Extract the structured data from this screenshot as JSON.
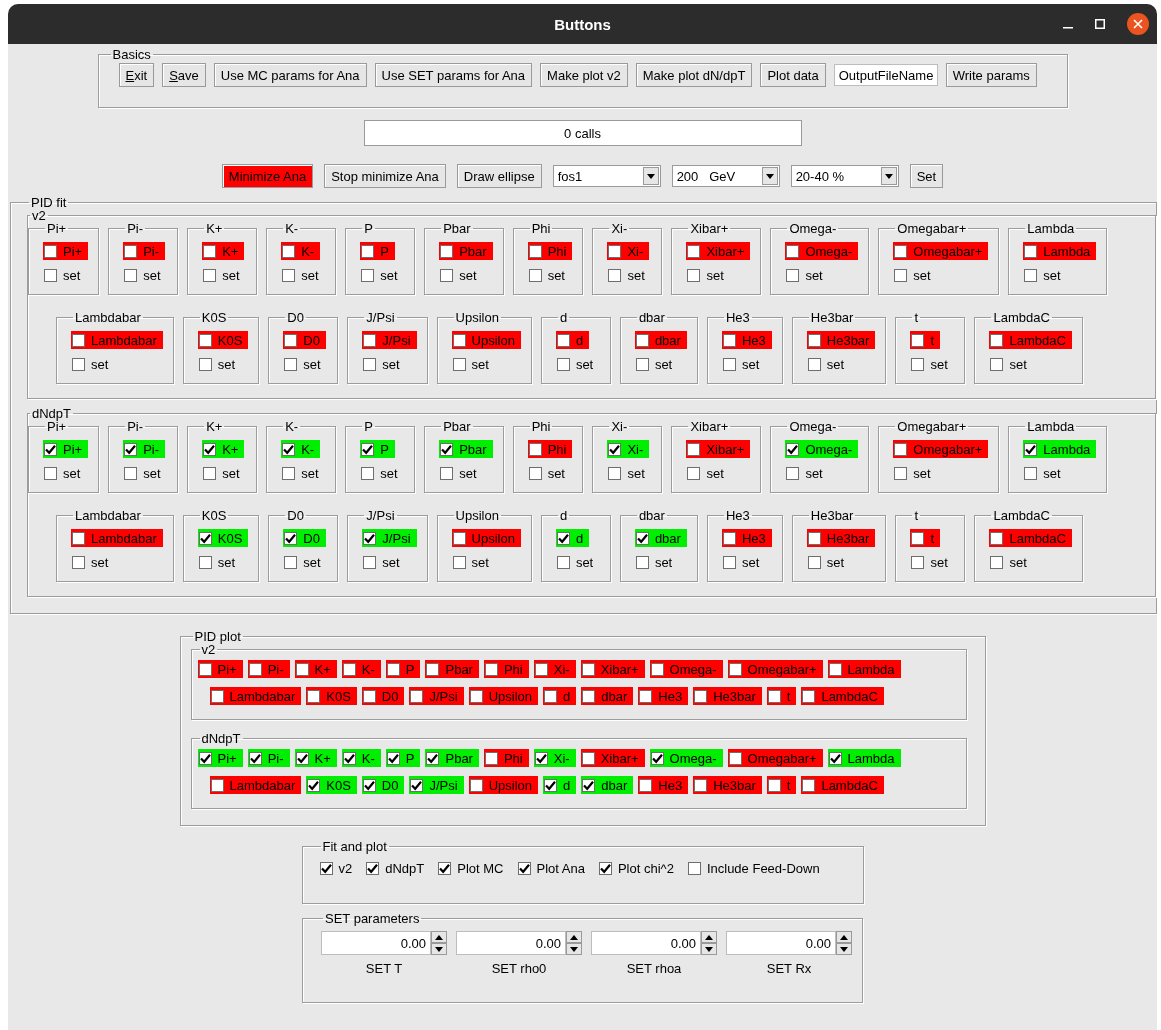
{
  "window": {
    "title": "Buttons"
  },
  "basics": {
    "title": "Basics",
    "items": [
      {
        "kind": "button",
        "label": "Exit",
        "mnemonic": true
      },
      {
        "kind": "button",
        "label": "Save",
        "mnemonic": true
      },
      {
        "kind": "button",
        "label": "Use MC params for Ana",
        "mnemonic": false
      },
      {
        "kind": "button",
        "label": "Use SET params for Ana",
        "mnemonic": false
      },
      {
        "kind": "button",
        "label": "Make plot v2",
        "mnemonic": false
      },
      {
        "kind": "button",
        "label": "Make plot dN/dpT",
        "mnemonic": false
      },
      {
        "kind": "button",
        "label": "Plot data",
        "mnemonic": false
      },
      {
        "kind": "field",
        "value": "OutputFileName"
      },
      {
        "kind": "button",
        "label": "Write params",
        "mnemonic": false
      }
    ]
  },
  "status": {
    "value": "0 calls"
  },
  "controls": [
    {
      "kind": "button",
      "label": "Minimize Ana",
      "active": true
    },
    {
      "kind": "button",
      "label": "Stop minimize Ana",
      "active": false
    },
    {
      "kind": "button",
      "label": "Draw ellipse",
      "active": false
    },
    {
      "kind": "dropdown",
      "value": "fos1"
    },
    {
      "kind": "dropdown",
      "value": "200   GeV"
    },
    {
      "kind": "dropdown",
      "value": "20-40 %"
    },
    {
      "kind": "button",
      "label": "Set",
      "active": false
    }
  ],
  "pid_fit": {
    "title": "PID fit",
    "sections": [
      {
        "title": "v2",
        "row_1": [
          {
            "group": "Pi+",
            "label": "Pi+",
            "checked": false,
            "set": {
              "label": "set",
              "checked": false
            }
          },
          {
            "group": "Pi-",
            "label": "Pi-",
            "checked": false,
            "set": {
              "label": "set",
              "checked": false
            }
          },
          {
            "group": "K+",
            "label": "K+",
            "checked": false,
            "set": {
              "label": "set",
              "checked": false
            }
          },
          {
            "group": "K-",
            "label": "K-",
            "checked": false,
            "set": {
              "label": "set",
              "checked": false
            }
          },
          {
            "group": "P",
            "label": "P",
            "checked": false,
            "set": {
              "label": "set",
              "checked": false
            }
          },
          {
            "group": "Pbar",
            "label": "Pbar",
            "checked": false,
            "set": {
              "label": "set",
              "checked": false
            }
          },
          {
            "group": "Phi",
            "label": "Phi",
            "checked": false,
            "set": {
              "label": "set",
              "checked": false
            }
          },
          {
            "group": "Xi-",
            "label": "Xi-",
            "checked": false,
            "set": {
              "label": "set",
              "checked": false
            }
          },
          {
            "group": "Xibar+",
            "label": "Xibar+",
            "checked": false,
            "set": {
              "label": "set",
              "checked": false
            }
          },
          {
            "group": "Omega-",
            "label": "Omega-",
            "checked": false,
            "set": {
              "label": "set",
              "checked": false
            }
          },
          {
            "group": "Omegabar+",
            "label": "Omegabar+",
            "checked": false,
            "set": {
              "label": "set",
              "checked": false
            }
          },
          {
            "group": "Lambda",
            "label": "Lambda",
            "checked": false,
            "set": {
              "label": "set",
              "checked": false
            }
          }
        ],
        "row_2": [
          {
            "group": "Lambdabar",
            "label": "Lambdabar",
            "checked": false,
            "set": {
              "label": "set",
              "checked": false
            }
          },
          {
            "group": "K0S",
            "label": "K0S",
            "checked": false,
            "set": {
              "label": "set",
              "checked": false
            }
          },
          {
            "group": "D0",
            "label": "D0",
            "checked": false,
            "set": {
              "label": "set",
              "checked": false
            }
          },
          {
            "group": "J/Psi",
            "label": "J/Psi",
            "checked": false,
            "set": {
              "label": "set",
              "checked": false
            }
          },
          {
            "group": "Upsilon",
            "label": "Upsilon",
            "checked": false,
            "set": {
              "label": "set",
              "checked": false
            }
          },
          {
            "group": "d",
            "label": "d",
            "checked": false,
            "set": {
              "label": "set",
              "checked": false
            }
          },
          {
            "group": "dbar",
            "label": "dbar",
            "checked": false,
            "set": {
              "label": "set",
              "checked": false
            }
          },
          {
            "group": "He3",
            "label": "He3",
            "checked": false,
            "set": {
              "label": "set",
              "checked": false
            }
          },
          {
            "group": "He3bar",
            "label": "He3bar",
            "checked": false,
            "set": {
              "label": "set",
              "checked": false
            }
          },
          {
            "group": "t",
            "label": "t",
            "checked": false,
            "set": {
              "label": "set",
              "checked": false
            }
          },
          {
            "group": "LambdaC",
            "label": "LambdaC",
            "checked": false,
            "set": {
              "label": "set",
              "checked": false
            }
          }
        ]
      },
      {
        "title": "dNdpT",
        "row_1": [
          {
            "group": "Pi+",
            "label": "Pi+",
            "checked": true,
            "set": {
              "label": "set",
              "checked": false
            }
          },
          {
            "group": "Pi-",
            "label": "Pi-",
            "checked": true,
            "set": {
              "label": "set",
              "checked": false
            }
          },
          {
            "group": "K+",
            "label": "K+",
            "checked": true,
            "set": {
              "label": "set",
              "checked": false
            }
          },
          {
            "group": "K-",
            "label": "K-",
            "checked": true,
            "set": {
              "label": "set",
              "checked": false
            }
          },
          {
            "group": "P",
            "label": "P",
            "checked": true,
            "set": {
              "label": "set",
              "checked": false
            }
          },
          {
            "group": "Pbar",
            "label": "Pbar",
            "checked": true,
            "set": {
              "label": "set",
              "checked": false
            }
          },
          {
            "group": "Phi",
            "label": "Phi",
            "checked": false,
            "set": {
              "label": "set",
              "checked": false
            }
          },
          {
            "group": "Xi-",
            "label": "Xi-",
            "checked": true,
            "set": {
              "label": "set",
              "checked": false
            }
          },
          {
            "group": "Xibar+",
            "label": "Xibar+",
            "checked": false,
            "set": {
              "label": "set",
              "checked": false
            }
          },
          {
            "group": "Omega-",
            "label": "Omega-",
            "checked": true,
            "set": {
              "label": "set",
              "checked": false
            }
          },
          {
            "group": "Omegabar+",
            "label": "Omegabar+",
            "checked": false,
            "set": {
              "label": "set",
              "checked": false
            }
          },
          {
            "group": "Lambda",
            "label": "Lambda",
            "checked": true,
            "set": {
              "label": "set",
              "checked": false
            }
          }
        ],
        "row_2": [
          {
            "group": "Lambdabar",
            "label": "Lambdabar",
            "checked": false,
            "set": {
              "label": "set",
              "checked": false
            }
          },
          {
            "group": "K0S",
            "label": "K0S",
            "checked": true,
            "set": {
              "label": "set",
              "checked": false
            }
          },
          {
            "group": "D0",
            "label": "D0",
            "checked": true,
            "set": {
              "label": "set",
              "checked": false
            }
          },
          {
            "group": "J/Psi",
            "label": "J/Psi",
            "checked": true,
            "set": {
              "label": "set",
              "checked": false
            }
          },
          {
            "group": "Upsilon",
            "label": "Upsilon",
            "checked": false,
            "set": {
              "label": "set",
              "checked": false
            }
          },
          {
            "group": "d",
            "label": "d",
            "checked": true,
            "set": {
              "label": "set",
              "checked": false
            }
          },
          {
            "group": "dbar",
            "label": "dbar",
            "checked": true,
            "set": {
              "label": "set",
              "checked": false
            }
          },
          {
            "group": "He3",
            "label": "He3",
            "checked": false,
            "set": {
              "label": "set",
              "checked": false
            }
          },
          {
            "group": "He3bar",
            "label": "He3bar",
            "checked": false,
            "set": {
              "label": "set",
              "checked": false
            }
          },
          {
            "group": "t",
            "label": "t",
            "checked": false,
            "set": {
              "label": "set",
              "checked": false
            }
          },
          {
            "group": "LambdaC",
            "label": "LambdaC",
            "checked": false,
            "set": {
              "label": "set",
              "checked": false
            }
          }
        ]
      }
    ]
  },
  "pid_plot": {
    "title": "PID plot",
    "sections": [
      {
        "title": "v2",
        "row_1": [
          {
            "label": "Pi+",
            "checked": false
          },
          {
            "label": "Pi-",
            "checked": false
          },
          {
            "label": "K+",
            "checked": false
          },
          {
            "label": "K-",
            "checked": false
          },
          {
            "label": "P",
            "checked": false
          },
          {
            "label": "Pbar",
            "checked": false
          },
          {
            "label": "Phi",
            "checked": false
          },
          {
            "label": "Xi-",
            "checked": false
          },
          {
            "label": "Xibar+",
            "checked": false
          },
          {
            "label": "Omega-",
            "checked": false
          },
          {
            "label": "Omegabar+",
            "checked": false
          },
          {
            "label": "Lambda",
            "checked": false
          }
        ],
        "row_2": [
          {
            "label": "Lambdabar",
            "checked": false
          },
          {
            "label": "K0S",
            "checked": false
          },
          {
            "label": "D0",
            "checked": false
          },
          {
            "label": "J/Psi",
            "checked": false
          },
          {
            "label": "Upsilon",
            "checked": false
          },
          {
            "label": "d",
            "checked": false
          },
          {
            "label": "dbar",
            "checked": false
          },
          {
            "label": "He3",
            "checked": false
          },
          {
            "label": "He3bar",
            "checked": false
          },
          {
            "label": "t",
            "checked": false
          },
          {
            "label": "LambdaC",
            "checked": false
          }
        ]
      },
      {
        "title": "dNdpT",
        "row_1": [
          {
            "label": "Pi+",
            "checked": true
          },
          {
            "label": "Pi-",
            "checked": true
          },
          {
            "label": "K+",
            "checked": true
          },
          {
            "label": "K-",
            "checked": true
          },
          {
            "label": "P",
            "checked": true
          },
          {
            "label": "Pbar",
            "checked": true
          },
          {
            "label": "Phi",
            "checked": false
          },
          {
            "label": "Xi-",
            "checked": true
          },
          {
            "label": "Xibar+",
            "checked": false
          },
          {
            "label": "Omega-",
            "checked": true
          },
          {
            "label": "Omegabar+",
            "checked": false
          },
          {
            "label": "Lambda",
            "checked": true
          }
        ],
        "row_2": [
          {
            "label": "Lambdabar",
            "checked": false
          },
          {
            "label": "K0S",
            "checked": true
          },
          {
            "label": "D0",
            "checked": true
          },
          {
            "label": "J/Psi",
            "checked": true
          },
          {
            "label": "Upsilon",
            "checked": false
          },
          {
            "label": "d",
            "checked": true
          },
          {
            "label": "dbar",
            "checked": true
          },
          {
            "label": "He3",
            "checked": false
          },
          {
            "label": "He3bar",
            "checked": false
          },
          {
            "label": "t",
            "checked": false
          },
          {
            "label": "LambdaC",
            "checked": false
          }
        ]
      }
    ]
  },
  "fit_and_plot": {
    "title": "Fit and plot",
    "options": [
      {
        "label": "v2",
        "checked": true
      },
      {
        "label": "dNdpT",
        "checked": true
      },
      {
        "label": "Plot MC",
        "checked": true
      },
      {
        "label": "Plot Ana",
        "checked": true
      },
      {
        "label": "Plot chi^2",
        "checked": true
      },
      {
        "label": "Include Feed-Down",
        "checked": false
      }
    ]
  },
  "set_parameters": {
    "title": "SET parameters",
    "fields": [
      {
        "value": "0.00",
        "label": "SET T"
      },
      {
        "value": "0.00",
        "label": "SET rho0"
      },
      {
        "value": "0.00",
        "label": "SET rhoa"
      },
      {
        "value": "0.00",
        "label": "SET Rx"
      }
    ]
  }
}
